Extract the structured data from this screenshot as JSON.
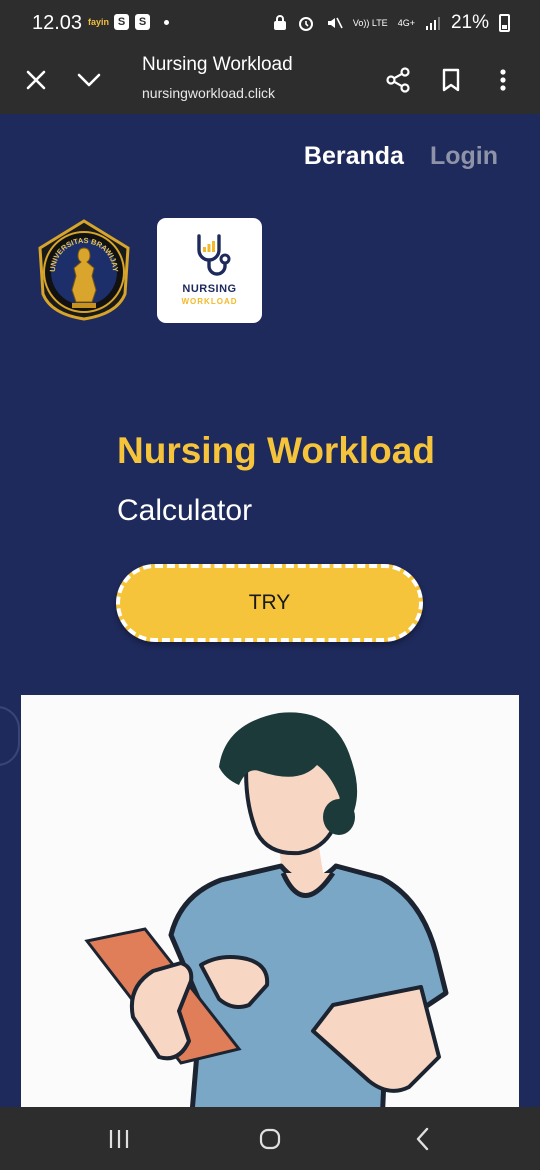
{
  "status_bar": {
    "time": "12.03",
    "notif_app": "fayin",
    "notif_shop1": "S",
    "notif_shop2": "S",
    "net_volte": "Vo)) LTE",
    "net_4g": "4G+",
    "battery": "21%"
  },
  "browser": {
    "page_title": "Nursing Workload",
    "url": "nursingworkload.click",
    "icons": [
      "close-icon",
      "chevron-down-icon",
      "share-icon",
      "bookmark-icon",
      "more-vert-icon"
    ]
  },
  "nav": {
    "home": "Beranda",
    "login": "Login"
  },
  "logos": {
    "university_seal_text": "UNIVERSITAS BRAWIJAYA",
    "app_logo_line1": "NURSING",
    "app_logo_line2": "WORKLOAD"
  },
  "hero": {
    "title": "Nursing Workload",
    "subtitle": "Calculator",
    "cta": "TRY"
  },
  "system_nav": {
    "icons": [
      "recents-icon",
      "home-icon",
      "back-icon"
    ]
  },
  "colors": {
    "background": "#1e2a5c",
    "accent": "#f6c43a",
    "chrome": "#2d2d2d"
  }
}
